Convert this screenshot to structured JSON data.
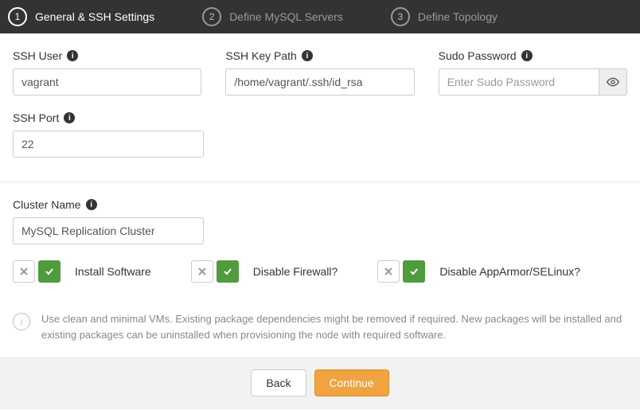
{
  "steps": [
    {
      "num": "1",
      "label": "General & SSH Settings"
    },
    {
      "num": "2",
      "label": "Define MySQL Servers"
    },
    {
      "num": "3",
      "label": "Define Topology"
    }
  ],
  "fields": {
    "ssh_user": {
      "label": "SSH User",
      "value": "vagrant"
    },
    "ssh_key_path": {
      "label": "SSH Key Path",
      "value": "/home/vagrant/.ssh/id_rsa"
    },
    "sudo_password": {
      "label": "Sudo Password",
      "placeholder": "Enter Sudo Password",
      "value": ""
    },
    "ssh_port": {
      "label": "SSH Port",
      "value": "22"
    },
    "cluster_name": {
      "label": "Cluster Name",
      "value": "MySQL Replication Cluster"
    }
  },
  "toggles": {
    "install_software": {
      "label": "Install Software"
    },
    "disable_firewall": {
      "label": "Disable Firewall?"
    },
    "disable_apparmor": {
      "label": "Disable AppArmor/SELinux?"
    }
  },
  "note": "Use clean and minimal VMs. Existing package dependencies might be removed if required. New packages will be installed and existing packages can be uninstalled when provisioning the node with required software.",
  "buttons": {
    "back": "Back",
    "continue": "Continue"
  }
}
